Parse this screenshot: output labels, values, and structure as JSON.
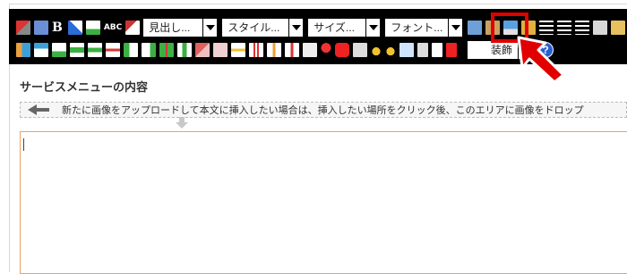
{
  "toolbar": {
    "bold_label": "B",
    "spell_label": "ABC",
    "dropdowns": [
      {
        "value": "見出し..."
      },
      {
        "value": "スタイル..."
      },
      {
        "value": "サイズ..."
      },
      {
        "value": "フォント..."
      },
      {
        "value": "装飾"
      }
    ],
    "help_label": "?",
    "colors": {
      "highlight": "#e00000",
      "toolbar_bg": "#000000"
    }
  },
  "editor": {
    "section_title": "サービスメニューの内容",
    "dropzone_text": "新たに画像をアップロードして本文に挿入したい場合は、挿入したい場所をクリック後、このエリアに画像をドロップ",
    "content": ""
  }
}
